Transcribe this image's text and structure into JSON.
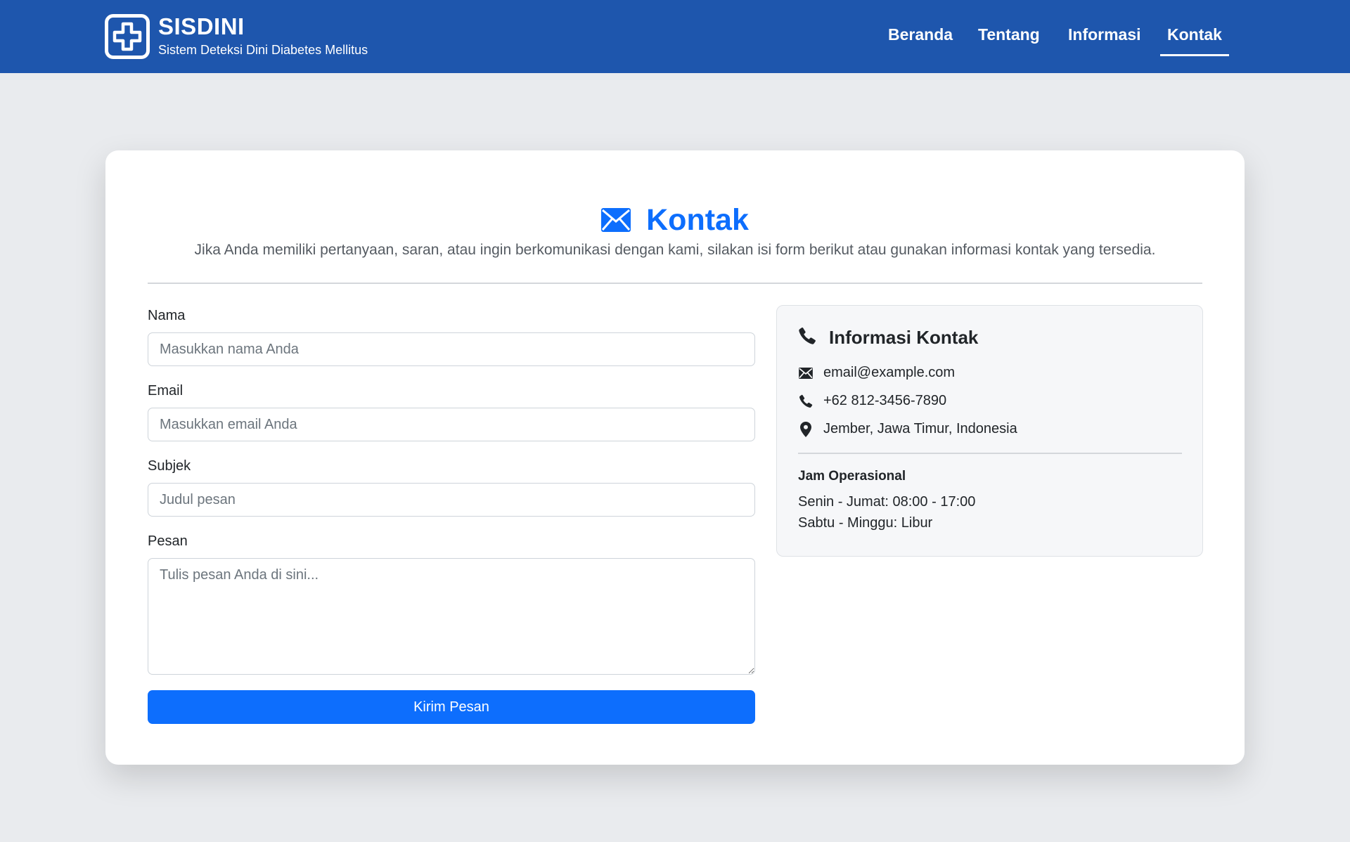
{
  "navbar": {
    "brand_title": "SISDINI",
    "brand_subtitle": "Sistem Deteksi Dini Diabetes Mellitus",
    "logo_icon": "medical-cross-icon",
    "links": [
      {
        "label": "Beranda",
        "active": false
      },
      {
        "label": "Tentang",
        "active": false
      },
      {
        "label": "Informasi",
        "active": false
      },
      {
        "label": "Kontak",
        "active": true
      }
    ],
    "background": "#1e56ad"
  },
  "page": {
    "title": "Kontak",
    "title_icon": "envelope-icon",
    "description": "Jika Anda memiliki pertanyaan, saran, atau ingin berkomunikasi dengan kami, silakan isi form berikut atau gunakan informasi kontak yang tersedia.",
    "accent": "#0d6efd"
  },
  "form": {
    "name_label": "Nama",
    "name_placeholder": "Masukkan nama Anda",
    "email_label": "Email",
    "email_placeholder": "Masukkan email Anda",
    "subject_label": "Subjek",
    "subject_placeholder": "Judul pesan",
    "message_label": "Pesan",
    "message_placeholder": "Tulis pesan Anda di sini...",
    "submit_label": "Kirim Pesan"
  },
  "contact_info": {
    "title": "Informasi Kontak",
    "title_icon": "phone-icon",
    "items": [
      {
        "icon": "envelope-icon",
        "value": "email@example.com"
      },
      {
        "icon": "phone-icon",
        "value": "+62 812-3456-7890"
      },
      {
        "icon": "map-pin-icon",
        "value": "Jember, Jawa Timur, Indonesia"
      }
    ],
    "hours_title": "Jam Operasional",
    "hours": [
      "Senin - Jumat: 08:00 - 17:00",
      "Sabtu - Minggu: Libur"
    ]
  }
}
